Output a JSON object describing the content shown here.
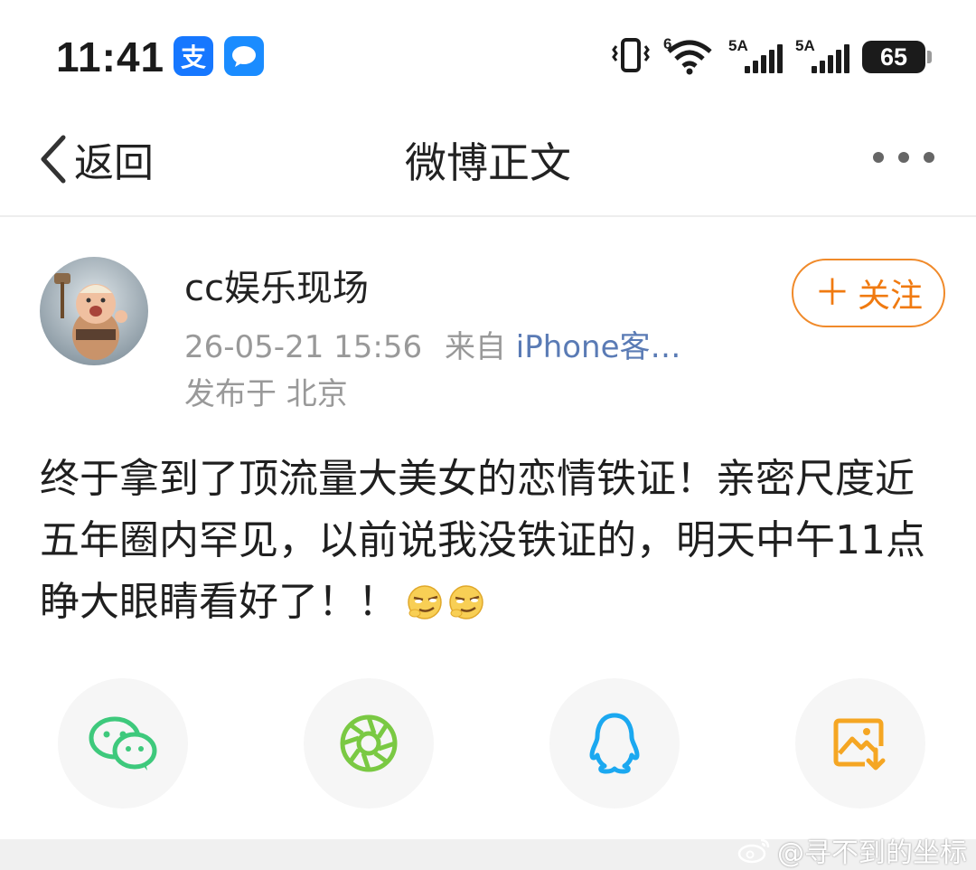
{
  "status_bar": {
    "time": "11:41",
    "alipay_glyph": "支",
    "signal1_label": "5A",
    "signal2_label": "5A",
    "wifi_label": "6",
    "battery": "65",
    "icons": [
      "alipay-icon",
      "message-icon",
      "vibrate-icon",
      "wifi-icon",
      "signal-icon",
      "signal-icon",
      "battery-icon"
    ]
  },
  "nav": {
    "back_label": "返回",
    "title": "微博正文"
  },
  "post": {
    "author": "cc娱乐现场",
    "date": "26-05-21 15:56",
    "source_prefix": "来自",
    "source": "iPhone客…",
    "location": "发布于 北京",
    "follow_label": "关注",
    "text": "终于拿到了顶流量大美女的恋情铁证！亲密尺度近五年圈内罕见，以前说我没铁证的，明天中午11点睁大眼睛看好了！！"
  },
  "share": {
    "icons": [
      "wechat-icon",
      "moments-icon",
      "qq-icon",
      "save-image-icon"
    ],
    "colors": {
      "wechat": "#3ec97c",
      "moments": "#7ac943",
      "qq": "#1ba8f0",
      "save": "#f5a623"
    }
  },
  "watermark": "@寻不到的坐标",
  "colors": {
    "accent": "#f07a10",
    "source_link": "#5a7bb5",
    "meta": "#999999"
  }
}
